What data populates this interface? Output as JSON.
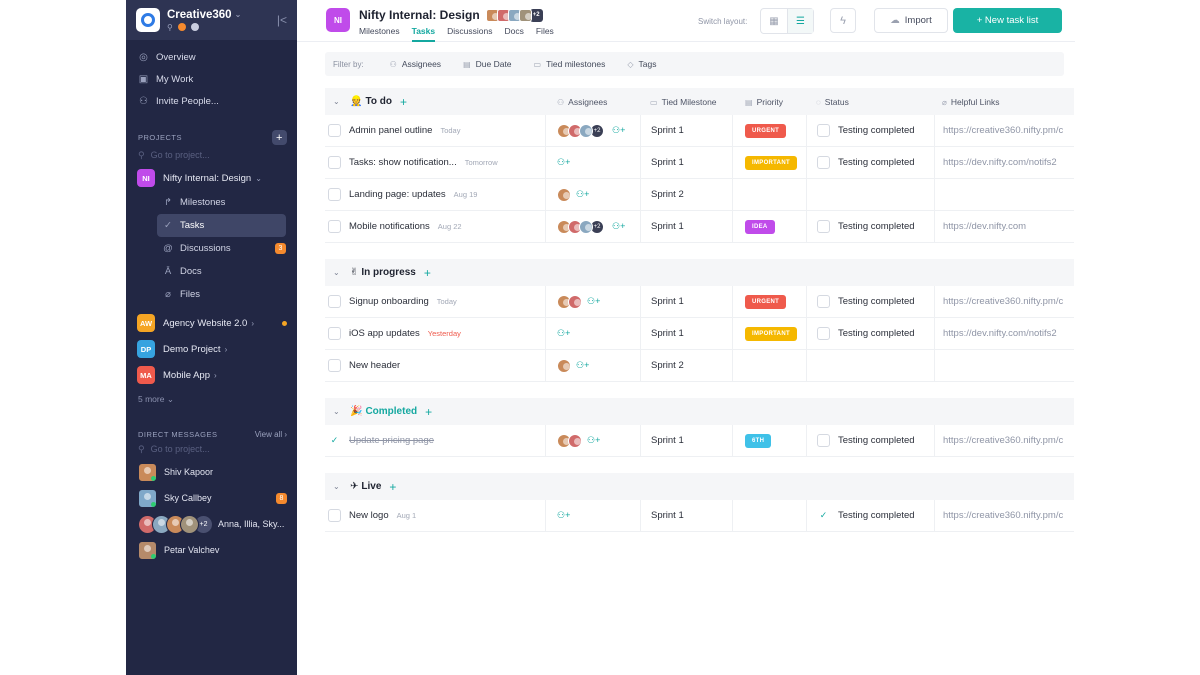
{
  "workspace": {
    "name": "Creative360"
  },
  "nav": [
    {
      "label": "Overview",
      "icon": "overview-icon",
      "glyph": "◎"
    },
    {
      "label": "My Work",
      "icon": "briefcase-icon",
      "glyph": "▣"
    },
    {
      "label": "Invite People...",
      "icon": "add-user-icon",
      "glyph": "⚇"
    }
  ],
  "projects_section": {
    "label": "PROJECTS",
    "search_placeholder": "Go to project..."
  },
  "projects": [
    {
      "badge": "NI",
      "name": "Nifty Internal: Design",
      "color": "#c04bea",
      "expanded": true
    },
    {
      "badge": "AW",
      "name": "Agency Website 2.0",
      "color": "#f5a524",
      "unread": true
    },
    {
      "badge": "DP",
      "name": "Demo Project",
      "color": "#36a3e0"
    },
    {
      "badge": "MA",
      "name": "Mobile App",
      "color": "#ef5a4c"
    }
  ],
  "subnav": [
    {
      "label": "Milestones",
      "icon": "milestone-icon",
      "glyph": "↱"
    },
    {
      "label": "Tasks",
      "icon": "check-icon",
      "glyph": "✓",
      "active": true
    },
    {
      "label": "Discussions",
      "icon": "at-icon",
      "glyph": "@",
      "badge": "3"
    },
    {
      "label": "Docs",
      "icon": "doc-icon",
      "glyph": "Ā"
    },
    {
      "label": "Files",
      "icon": "paperclip-icon",
      "glyph": "⌀"
    }
  ],
  "more_projects": "5 more",
  "dm_section": {
    "label": "DIRECT MESSAGES",
    "view_all": "View all",
    "search_placeholder": "Go to project..."
  },
  "direct_messages": [
    {
      "name": "Shiv Kapoor",
      "color": "#c98a5a"
    },
    {
      "name": "Sky Callbey",
      "color": "#7fa8c9",
      "badge": "8"
    },
    {
      "name": "Anna, Illia, Sky...",
      "group": true,
      "more": "+2"
    },
    {
      "name": "Petar Valchev",
      "color": "#b58a6a"
    }
  ],
  "header": {
    "badge": "NI",
    "title": "Nifty Internal: Design",
    "title_more": "+2",
    "tabs": [
      "Milestones",
      "Tasks",
      "Discussions",
      "Docs",
      "Files"
    ],
    "active_tab": "Tasks",
    "switch_layout_label": "Switch layout:",
    "import_label": "Import",
    "new_task_list_label": "+ New task list"
  },
  "filters": {
    "label": "Filter by:",
    "items": [
      {
        "label": "Assignees",
        "icon": "assignee-icon"
      },
      {
        "label": "Due Date",
        "icon": "calendar-icon"
      },
      {
        "label": "Tied milestones",
        "icon": "milestone-icon"
      },
      {
        "label": "Tags",
        "icon": "tag-icon"
      }
    ]
  },
  "columns": {
    "assignees": "Assignees",
    "milestone": "Tied Milestone",
    "priority": "Priority",
    "status": "Status",
    "links": "Helpful Links"
  },
  "priority_colors": {
    "URGENT": "#ef5a4c",
    "IMPORTANT": "#f5b800",
    "IDEA": "#c04bea",
    "6TH": "#3fc1e8"
  },
  "groups": [
    {
      "name": "To do",
      "emoji": "👷",
      "green": false,
      "tasks": [
        {
          "name": "Admin panel outline",
          "date": "Today",
          "date_red": false,
          "assignees": 3,
          "more": "+2",
          "milestone": "Sprint 1",
          "priority": "URGENT",
          "status": "Testing completed",
          "status_done": false,
          "link": "https://creative360.nifty.pm/c"
        },
        {
          "name": "Tasks: show notification...",
          "date": "Tomorrow",
          "date_red": false,
          "assignees": 0,
          "milestone": "Sprint 1",
          "priority": "IMPORTANT",
          "status": "Testing completed",
          "status_done": false,
          "link": "https://dev.nifty.com/notifs2"
        },
        {
          "name": "Landing page: updates",
          "date": "Aug 19",
          "date_red": false,
          "assignees": 1,
          "milestone": "Sprint 2",
          "priority": "",
          "status": "",
          "link": ""
        },
        {
          "name": "Mobile notifications",
          "date": "Aug 22",
          "date_red": false,
          "assignees": 3,
          "more": "+2",
          "milestone": "Sprint 1",
          "priority": "IDEA",
          "status": "Testing completed",
          "status_done": false,
          "link": "https://dev.nifty.com"
        }
      ]
    },
    {
      "name": "In progress",
      "emoji": "✌",
      "green": false,
      "tasks": [
        {
          "name": "Signup onboarding",
          "date": "Today",
          "date_red": false,
          "assignees": 2,
          "milestone": "Sprint 1",
          "priority": "URGENT",
          "status": "Testing completed",
          "status_done": false,
          "link": "https://creative360.nifty.pm/c"
        },
        {
          "name": "iOS app updates",
          "date": "Yesterday",
          "date_red": true,
          "assignees": 0,
          "milestone": "Sprint 1",
          "priority": "IMPORTANT",
          "status": "Testing completed",
          "status_done": false,
          "link": "https://dev.nifty.com/notifs2"
        },
        {
          "name": "New header",
          "date": "",
          "date_red": false,
          "assignees": 1,
          "milestone": "Sprint 2",
          "priority": "",
          "status": "",
          "link": ""
        }
      ]
    },
    {
      "name": "Completed",
      "emoji": "🎉",
      "green": true,
      "tasks": [
        {
          "name": "Update pricing page",
          "date": "",
          "done": true,
          "assignees": 2,
          "milestone": "Sprint 1",
          "priority": "6TH",
          "status": "Testing completed",
          "status_done": false,
          "link": "https://creative360.nifty.pm/c"
        }
      ]
    },
    {
      "name": "Live",
      "emoji": "✈",
      "green": false,
      "tasks": [
        {
          "name": "New logo",
          "date": "Aug 1",
          "date_red": false,
          "assignees": 0,
          "milestone": "Sprint 1",
          "priority": "",
          "status": "Testing completed",
          "status_done": true,
          "link": "https://creative360.nifty.pm/c"
        }
      ]
    }
  ]
}
